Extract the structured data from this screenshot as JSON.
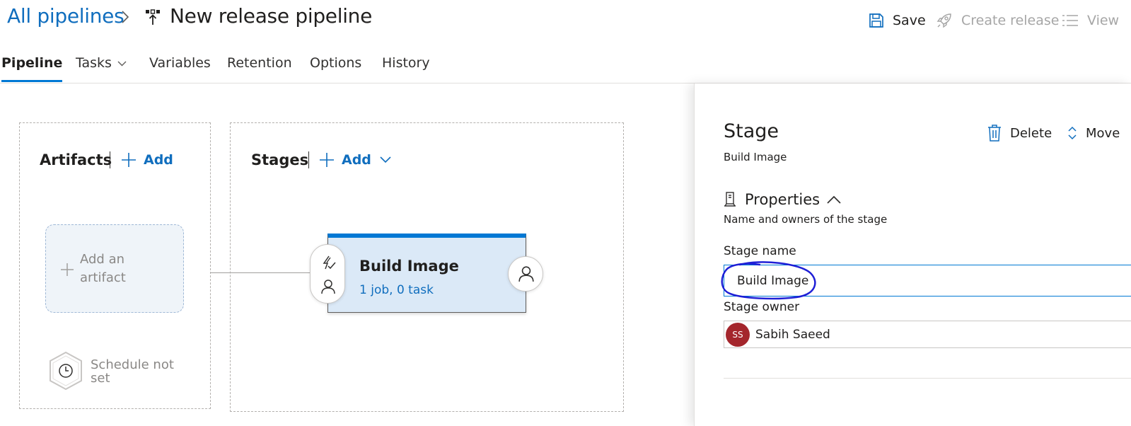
{
  "breadcrumb": {
    "root": "All pipelines",
    "title": "New release pipeline"
  },
  "toolbar": {
    "save": "Save",
    "create_release": "Create release",
    "view": "View"
  },
  "tabs": [
    {
      "label": "Pipeline",
      "active": true
    },
    {
      "label": "Tasks",
      "active": false,
      "has_dropdown": true
    },
    {
      "label": "Variables",
      "active": false
    },
    {
      "label": "Retention",
      "active": false
    },
    {
      "label": "Options",
      "active": false
    },
    {
      "label": "History",
      "active": false
    }
  ],
  "artifacts": {
    "title": "Artifacts",
    "add": "Add",
    "placeholder": "Add an artifact",
    "schedule": "Schedule not set"
  },
  "stages": {
    "title": "Stages",
    "add": "Add",
    "stage": {
      "name": "Build Image",
      "summary": "1 job, 0 task"
    }
  },
  "panel": {
    "title": "Stage",
    "subtitle": "Build Image",
    "delete": "Delete",
    "move": "Move",
    "properties": {
      "heading": "Properties",
      "description": "Name and owners of the stage",
      "stage_name_label": "Stage name",
      "stage_name_value": "Build Image",
      "stage_owner_label": "Stage owner",
      "owner": {
        "initials": "SS",
        "name": "Sabih Saeed"
      }
    }
  },
  "colors": {
    "accent": "#0078d4",
    "link": "#106ebe",
    "avatar": "#a4262c",
    "annotation": "#1f1fd6"
  },
  "icons": [
    "chevron-right-icon",
    "pipeline-icon",
    "save-icon",
    "rocket-icon",
    "list-icon",
    "chevron-down-icon",
    "plus-icon",
    "clock-icon",
    "lightning-check-icon",
    "person-icon",
    "trash-icon",
    "up-down-icon",
    "properties-icon",
    "chevron-up-icon"
  ]
}
